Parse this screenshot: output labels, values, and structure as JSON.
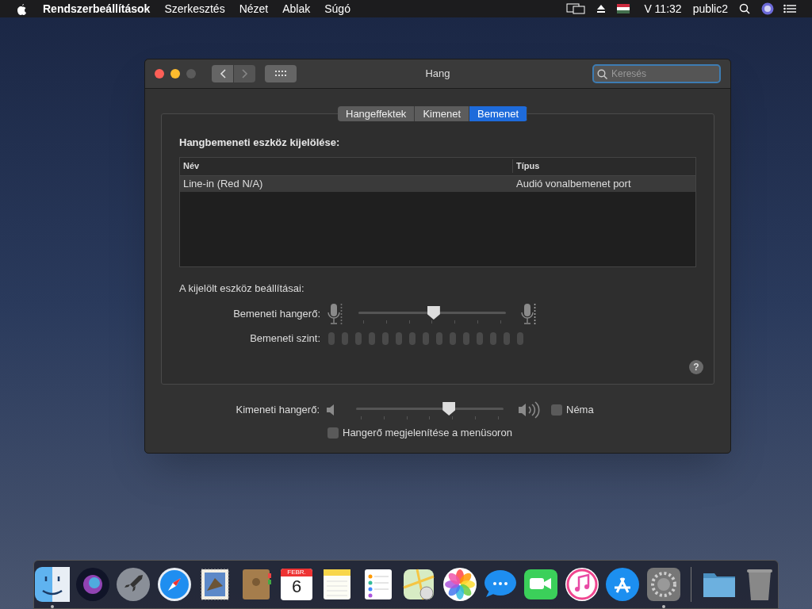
{
  "menubar": {
    "app": "Rendszerbeállítások",
    "menus": [
      "Szerkesztés",
      "Nézet",
      "Ablak",
      "Súgó"
    ],
    "clock": "V 11:32",
    "user": "public2"
  },
  "window": {
    "title": "Hang",
    "search": {
      "placeholder": "Keresés"
    }
  },
  "tabs": [
    {
      "label": "Hangeffektek",
      "selected": false
    },
    {
      "label": "Kimenet",
      "selected": false
    },
    {
      "label": "Bemenet",
      "selected": true
    }
  ],
  "input": {
    "heading": "Hangbemeneti eszköz kijelölése:",
    "table": {
      "columns": [
        "Név",
        "Típus"
      ],
      "rows": [
        {
          "cells": [
            "Line-in (Red N/A)",
            "Audió vonalbemenet port"
          ],
          "selected": false
        }
      ]
    },
    "settings_heading": "A kijelölt eszköz beállításai:",
    "volume": {
      "label": "Bemeneti hangerő:",
      "level": 0.51
    },
    "meter": {
      "label": "Bemeneti szint:"
    }
  },
  "help": "?",
  "output": {
    "label": "Kimeneti hangerő:",
    "level": 0.63,
    "mute": {
      "label": "Néma",
      "checked": false
    }
  },
  "show_in_menubar": {
    "label": "Hangerő megjelenítése a menüsoron",
    "checked": false
  },
  "dock": [
    {
      "kind": "finder",
      "running": true
    },
    {
      "kind": "siri",
      "running": false
    },
    {
      "kind": "launchpad",
      "running": false
    },
    {
      "kind": "safari",
      "running": false
    },
    {
      "kind": "mail",
      "running": false
    },
    {
      "kind": "contacts",
      "running": false
    },
    {
      "kind": "calendar",
      "running": false,
      "month": "FEBR.",
      "day": "6"
    },
    {
      "kind": "notes",
      "running": false
    },
    {
      "kind": "reminders",
      "running": false
    },
    {
      "kind": "maps",
      "running": false
    },
    {
      "kind": "photos",
      "running": false
    },
    {
      "kind": "messages",
      "running": false
    },
    {
      "kind": "facetime",
      "running": false
    },
    {
      "kind": "music",
      "running": false
    },
    {
      "kind": "appstore",
      "running": false
    },
    {
      "kind": "prefs",
      "running": true
    },
    {
      "kind": "separator"
    },
    {
      "kind": "folder",
      "running": false
    },
    {
      "kind": "trash",
      "running": false
    }
  ]
}
